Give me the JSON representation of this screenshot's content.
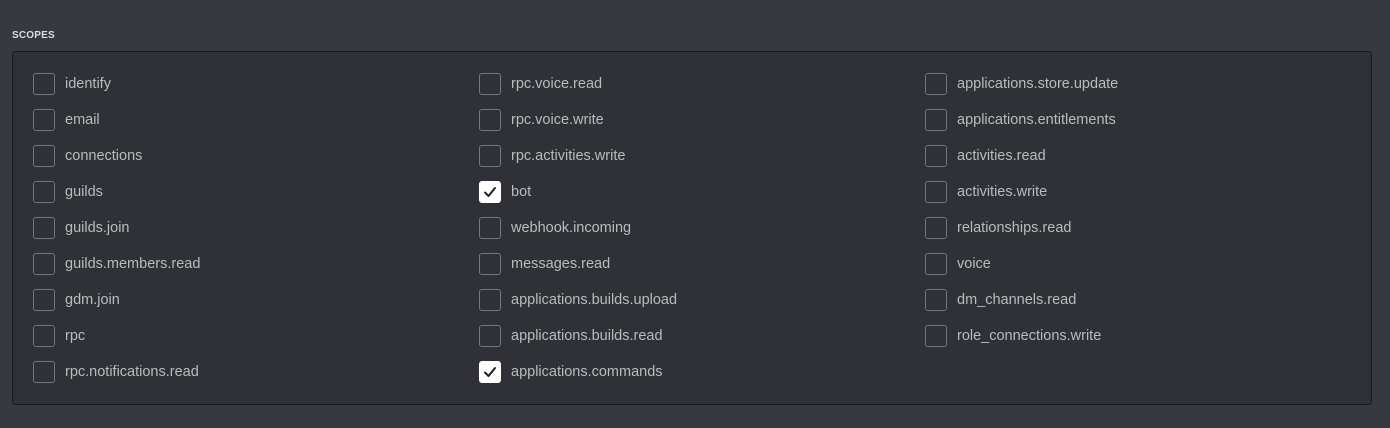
{
  "section_title": "SCOPES",
  "columns": [
    [
      {
        "label": "identify",
        "checked": false
      },
      {
        "label": "email",
        "checked": false
      },
      {
        "label": "connections",
        "checked": false
      },
      {
        "label": "guilds",
        "checked": false
      },
      {
        "label": "guilds.join",
        "checked": false
      },
      {
        "label": "guilds.members.read",
        "checked": false
      },
      {
        "label": "gdm.join",
        "checked": false
      },
      {
        "label": "rpc",
        "checked": false
      },
      {
        "label": "rpc.notifications.read",
        "checked": false
      }
    ],
    [
      {
        "label": "rpc.voice.read",
        "checked": false
      },
      {
        "label": "rpc.voice.write",
        "checked": false
      },
      {
        "label": "rpc.activities.write",
        "checked": false
      },
      {
        "label": "bot",
        "checked": true
      },
      {
        "label": "webhook.incoming",
        "checked": false
      },
      {
        "label": "messages.read",
        "checked": false
      },
      {
        "label": "applications.builds.upload",
        "checked": false
      },
      {
        "label": "applications.builds.read",
        "checked": false
      },
      {
        "label": "applications.commands",
        "checked": true
      }
    ],
    [
      {
        "label": "applications.store.update",
        "checked": false
      },
      {
        "label": "applications.entitlements",
        "checked": false
      },
      {
        "label": "activities.read",
        "checked": false
      },
      {
        "label": "activities.write",
        "checked": false
      },
      {
        "label": "relationships.read",
        "checked": false
      },
      {
        "label": "voice",
        "checked": false
      },
      {
        "label": "dm_channels.read",
        "checked": false
      },
      {
        "label": "role_connections.write",
        "checked": false
      }
    ]
  ],
  "colors": {
    "background": "#36393f",
    "panel": "#2f3136",
    "checkbox_border": "#72767d",
    "checked_fill": "#ffffff",
    "label_text": "#b9bbbe"
  }
}
